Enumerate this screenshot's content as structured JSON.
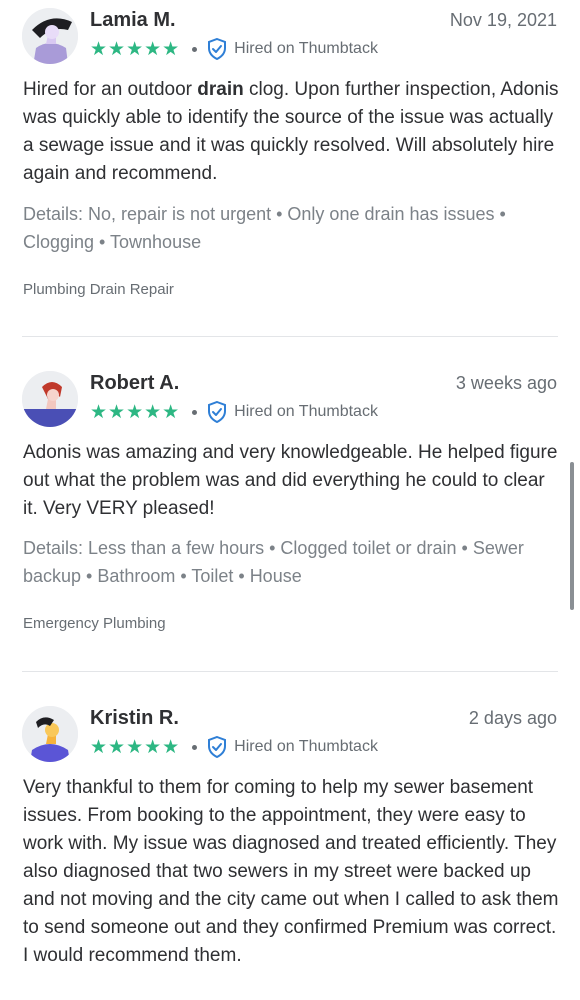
{
  "reviews": [
    {
      "name": "Lamia M.",
      "date": "Nov 19, 2021",
      "rating": 5,
      "stars": "★★★★★",
      "hired_label": "Hired on Thumbtack",
      "text_before": "Hired for an outdoor ",
      "text_bold": "drain",
      "text_after": " clog. Upon further inspection, Adonis was quickly able to identify the source of the issue was actually a sewage issue and it was quickly resolved. Will absolutely hire again and recommend.",
      "details": "Details: No, repair is not urgent • Only one drain has issues • Clogging • Townhouse",
      "service": "Plumbing Drain Repair"
    },
    {
      "name": "Robert A.",
      "date": "3 weeks ago",
      "rating": 5,
      "stars": "★★★★★",
      "hired_label": "Hired on Thumbtack",
      "text": "Adonis was amazing and very knowledgeable. He helped figure out what the problem was and did everything he could to clear it. Very VERY pleased!",
      "details": "Details: Less than a few hours • Clogged toilet or drain • Sewer backup • Bathroom • Toilet • House",
      "service": "Emergency Plumbing"
    },
    {
      "name": "Kristin R.",
      "date": "2 days ago",
      "rating": 5,
      "stars": "★★★★★",
      "hired_label": "Hired on Thumbtack",
      "text": "Very thankful to them for coming to help my sewer basement issues. From booking to the appointment, they were easy to work with. My issue was diagnosed and treated efficiently. They also diagnosed that two sewers in my street were backed up and not moving and the city came out when I called to ask them to send someone out and they confirmed Premium was correct. I would recommend them."
    }
  ],
  "colors": {
    "star": "#2db783",
    "verified": "#2f7fd6",
    "text": "#2f3033",
    "muted": "#7c8288"
  },
  "icons": [
    "avatar",
    "star-icon",
    "verified-shield-icon"
  ]
}
